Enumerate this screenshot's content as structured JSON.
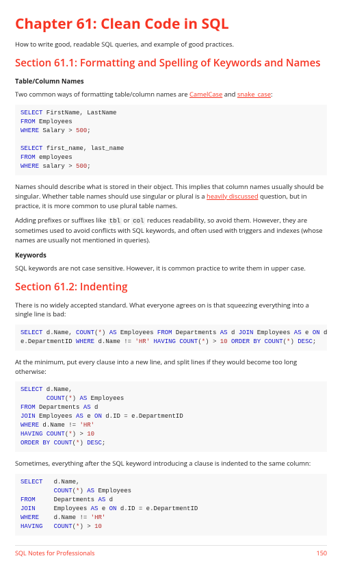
{
  "chapter_title": "Chapter 61: Clean Code in SQL",
  "intro": "How to write good, readable SQL queries, and example of good practices.",
  "section1": {
    "title": "Section 61.1: Formatting and Spelling of Keywords and Names",
    "sub1_title": "Table/Column Names",
    "p1_prefix": "Two common ways of formatting table/column names are ",
    "camel_link": "CamelCase",
    "p1_mid": " and ",
    "snake_link": "snake_case",
    "p1_suffix": ":",
    "p2_prefix": "Names should describe what is stored in their object. This implies that column names usually should be singular. Whether table names should use singular or plural is a ",
    "heavily_link": "heavily discussed",
    "p2_suffix": " question, but in practice, it is more common to use plural table names.",
    "p3_a": "Adding prefixes or suffixes like ",
    "p3_tbl": "tbl",
    "p3_b": " or ",
    "p3_col": "col",
    "p3_c": " reduces readability, so avoid them. However, they are sometimes used to avoid conflicts with SQL keywords, and often used with triggers and indexes (whose names are usually not mentioned in queries).",
    "sub2_title": "Keywords",
    "p4": "SQL keywords are not case sensitive. However, it is common practice to write them in upper case."
  },
  "section2": {
    "title": "Section 61.2: Indenting",
    "p1": "There is no widely accepted standard. What everyone agrees on is that squeezing everything into a single line is bad:",
    "p2": "At the minimum, put every clause into a new line, and split lines if they would become too long otherwise:",
    "p3": "Sometimes, everything after the SQL keyword introducing a clause is indented to the same column:"
  },
  "footer": {
    "left": "SQL Notes for Professionals",
    "right": "150"
  }
}
